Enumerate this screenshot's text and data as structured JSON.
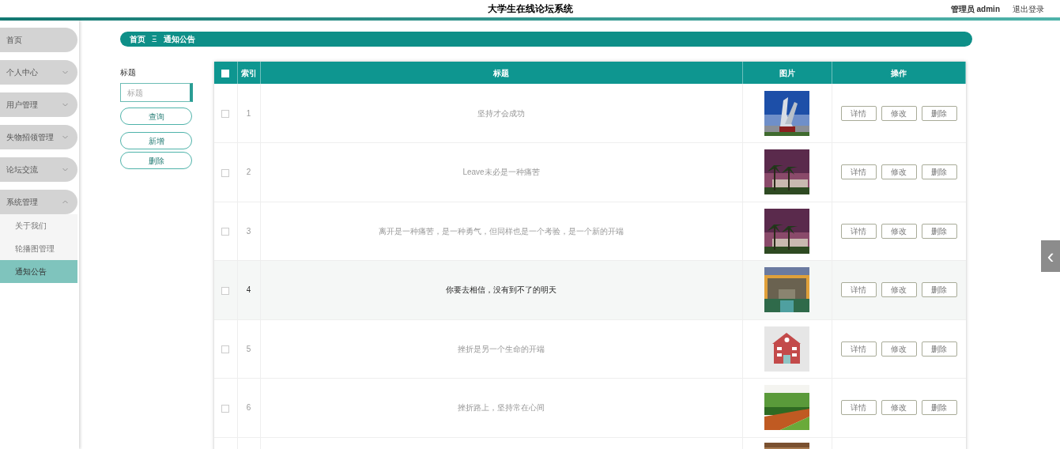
{
  "header": {
    "title": "大学生在线论坛系统",
    "user": "管理员 admin",
    "logout": "退出登录"
  },
  "sidebar": {
    "items": [
      {
        "label": "首页",
        "expandable": false
      },
      {
        "label": "个人中心",
        "expandable": true,
        "expanded": false
      },
      {
        "label": "用户管理",
        "expandable": true,
        "expanded": false
      },
      {
        "label": "失物招领管理",
        "expandable": true,
        "expanded": false
      },
      {
        "label": "论坛交流",
        "expandable": true,
        "expanded": false
      },
      {
        "label": "系统管理",
        "expandable": true,
        "expanded": true,
        "children": [
          {
            "label": "关于我们",
            "selected": false
          },
          {
            "label": "轮播图管理",
            "selected": false
          },
          {
            "label": "通知公告",
            "selected": true
          }
        ]
      }
    ]
  },
  "breadcrumb": {
    "home": "首页",
    "separator": "Ξ",
    "current": "通知公告"
  },
  "search": {
    "label": "标题",
    "placeholder": "标题",
    "buttons": [
      "查询",
      "新增",
      "删除"
    ]
  },
  "table": {
    "columns": [
      "索引",
      "标题",
      "图片",
      "操作"
    ],
    "header_checked": false,
    "rows": [
      {
        "index": "1",
        "title": "坚持才会成功",
        "checked": false,
        "highlighted": false,
        "picture": {
          "kind": "picture"
        },
        "actions": [
          "详情",
          "修改",
          "删除"
        ]
      },
      {
        "index": "2",
        "title": "Leave未必是一种痛苦",
        "checked": false,
        "highlighted": false,
        "picture": {
          "kind": "picture"
        },
        "actions": [
          "详情",
          "修改",
          "删除"
        ]
      },
      {
        "index": "3",
        "title": "离开是一种痛苦，是一种勇气，但同样也是一个考验，是一个新的开端",
        "checked": false,
        "highlighted": false,
        "picture": {
          "kind": "picture"
        },
        "actions": [
          "详情",
          "修改",
          "删除"
        ]
      },
      {
        "index": "4",
        "title": "你要去相信，没有到不了的明天",
        "checked": false,
        "highlighted": true,
        "picture": {
          "kind": "picture"
        },
        "actions": [
          "详情",
          "修改",
          "删除"
        ]
      },
      {
        "index": "5",
        "title": "挫折是另一个生命的开端",
        "checked": false,
        "highlighted": false,
        "picture": {
          "kind": "picture"
        },
        "actions": [
          "详情",
          "修改",
          "删除"
        ]
      },
      {
        "index": "6",
        "title": "挫折路上，坚持常在心间",
        "checked": false,
        "highlighted": false,
        "picture": {
          "kind": "picture"
        },
        "actions": [
          "详情",
          "修改",
          "删除"
        ]
      },
      {
        "picture": {
          "kind": "picture"
        }
      }
    ]
  },
  "side_toggle": {
    "icon": "‹"
  }
}
